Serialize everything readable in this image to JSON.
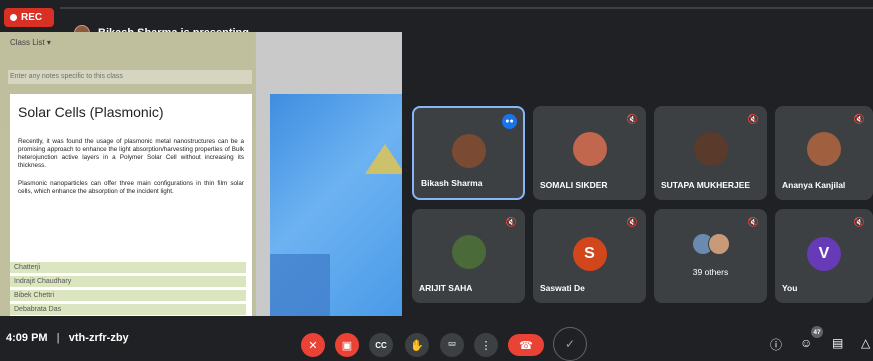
{
  "recording": {
    "label": "REC"
  },
  "presenter": {
    "text": "Bikash Sharma is presenting"
  },
  "shared_screen": {
    "class_list_label": "Class List ▾",
    "notes_placeholder": "Enter any notes specific to this class",
    "slide": {
      "title": "Solar Cells (Plasmonic)",
      "paragraph1": "Recently, it was found the usage of plasmonic metal nanostructures can be a promising approach to enhance the light absorption/harvesting properties of Bulk heterojunction active layers in a Polymer Solar Cell without increasing its thickness.",
      "paragraph2": "Plasmonic nanoparticles can offer three main configurations in thin film solar cells, which enhance the absorption of the incident light."
    },
    "bg_rows": [
      "Chatterji",
      "Indrajit Chaudhary",
      "Bibek Chettri",
      "Debabrata Das"
    ]
  },
  "participants": [
    {
      "name": "Bikash Sharma",
      "state": "speaking",
      "color": "#7a4a32"
    },
    {
      "name": "SOMALI SIKDER",
      "state": "muted",
      "color": "#c0674d"
    },
    {
      "name": "SUTAPA MUKHERJEE",
      "state": "muted",
      "color": "#5a3a2a"
    },
    {
      "name": "Ananya Kanjilal",
      "state": "muted",
      "color": "#a06040"
    },
    {
      "name": "ARIJIT SAHA",
      "state": "muted",
      "color": "#4a6a3a"
    },
    {
      "name": "Saswati De",
      "state": "muted",
      "letter": "S",
      "color": "#d2461b"
    },
    {
      "name": "39 others",
      "state": "muted",
      "color": "#6a8ab0"
    },
    {
      "name": "You",
      "state": "muted",
      "letter": "V",
      "color": "#673ab7"
    }
  ],
  "bottom_bar": {
    "time": "4:09 PM",
    "separator": "|",
    "meeting_code": "vth-zrfr-zby",
    "people_count": "47"
  },
  "icons": {
    "mic_off": "mic-off-icon",
    "camera_off": "camera-off-icon",
    "captions": "captions-icon",
    "raise_hand": "raise-hand-icon",
    "present": "present-icon",
    "more": "more-options-icon",
    "end_call": "end-call-icon",
    "info": "info-icon",
    "people": "people-icon",
    "chat": "chat-icon",
    "activities": "activities-icon"
  }
}
